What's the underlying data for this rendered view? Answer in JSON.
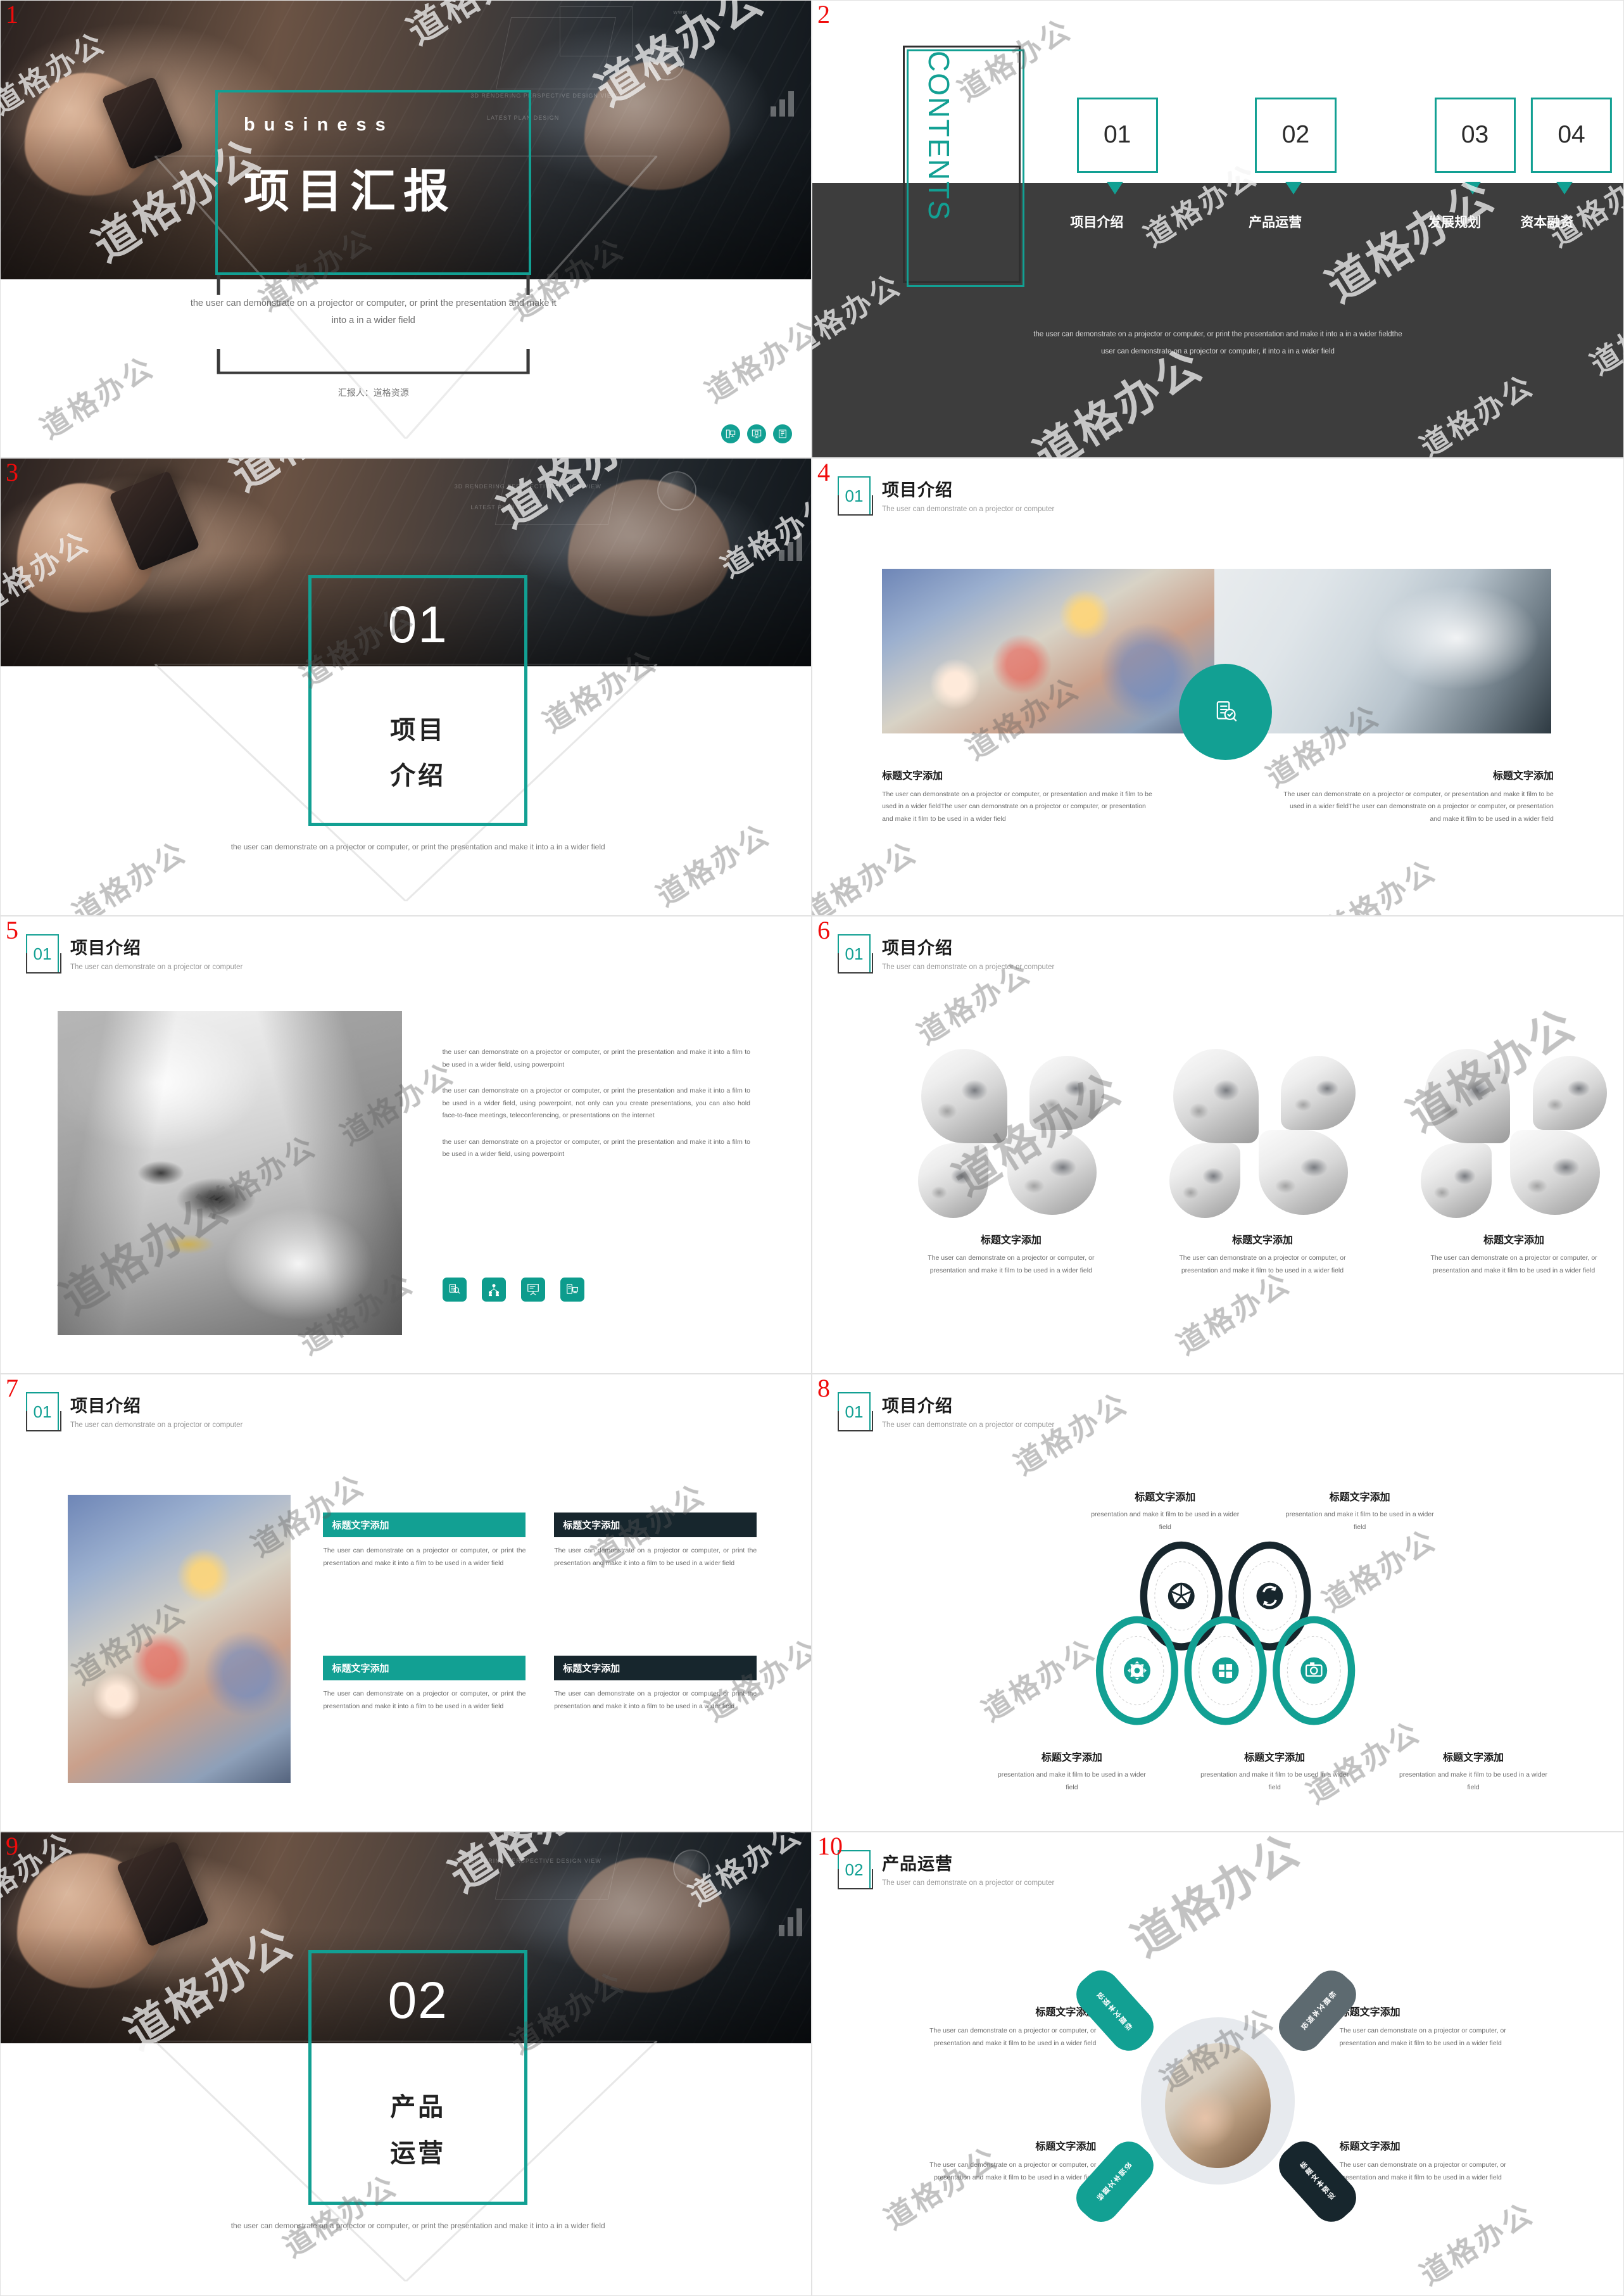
{
  "theme": {
    "teal": "#12a093",
    "dark_navy": "#17262d",
    "dark_gray": "#3d3d3d",
    "number_red": "#f00b0b"
  },
  "watermark": {
    "text": "道格办公"
  },
  "slides": [
    {
      "num": "1",
      "type": "cover",
      "english_title": "business",
      "chinese_title": "项目汇报",
      "subtitle": "the user can demonstrate on a projector or computer, or print the presentation  and make it into a in a wider field",
      "author": "汇报人：道格资源",
      "icons": [
        "desktop-computer-icon",
        "monitor-document-icon",
        "book-icon"
      ]
    },
    {
      "num": "2",
      "type": "contents",
      "word": "CONTENTS",
      "items": [
        {
          "number": "01",
          "label": "项目介绍"
        },
        {
          "number": "02",
          "label": "产品运营"
        },
        {
          "number": "03",
          "label": "发展规划"
        },
        {
          "number": "04",
          "label": "资本融资"
        }
      ],
      "footer_line1": "the user can demonstrate on a projector or computer, or print the presentation and make it into a in a wider fieldthe",
      "footer_line2": "user can demonstrate on a projector or computer, it into a in a wider field"
    },
    {
      "num": "3",
      "type": "divider",
      "number": "01",
      "title_line1": "项目",
      "title_line2": "介绍",
      "subtitle": "the user can demonstrate on a projector or computer, or print the presentation and make it into a in a wider field"
    },
    {
      "num": "4",
      "type": "content-two-col",
      "header": {
        "number": "01",
        "title": "项目介绍",
        "sub": "The user can demonstrate on a projector or computer"
      },
      "center_icon": "document-search-icon",
      "left": {
        "title": "标题文字添加",
        "body": "The user can demonstrate on a projector or computer, or presentation and make it film to be used in a wider fieldThe user can demonstrate on a projector or computer, or presentation and make it film to be used in a wider field"
      },
      "right": {
        "title": "标题文字添加",
        "body": "The user can demonstrate on a projector or computer, or presentation and make it film to be used in a wider fieldThe user can demonstrate on a projector or computer, or presentation and make it film to be used in a wider field"
      }
    },
    {
      "num": "5",
      "type": "content-image-text",
      "header": {
        "number": "01",
        "title": "项目介绍",
        "sub": "The user can demonstrate on a projector or computer"
      },
      "paragraphs": [
        "the user can demonstrate on a projector or computer, or print the presentation and make it into a film to be used in a wider field, using powerpoint",
        "the user can demonstrate on a projector or computer, or print the presentation and make it into a film to be used in a wider field, using powerpoint, not only can you create presentations, you can also hold face-to-face meetings, teleconferencing, or presentations on the internet",
        "the user can demonstrate on a projector or computer, or print the presentation and make it into a film to be used in a wider field, using powerpoint"
      ],
      "icons": [
        "document-search-icon",
        "network-people-icon",
        "presentation-board-icon",
        "document-monitor-icon"
      ]
    },
    {
      "num": "6",
      "type": "content-three-col",
      "header": {
        "number": "01",
        "title": "项目介绍",
        "sub": "The user can demonstrate on a projector or computer"
      },
      "columns": [
        {
          "title": "标题文字添加",
          "body": "The user can demonstrate on a projector or computer, or presentation and make it film to be used in a wider field"
        },
        {
          "title": "标题文字添加",
          "body": "The user can demonstrate on a projector or computer, or presentation and make it film to be used in a wider field"
        },
        {
          "title": "标题文字添加",
          "body": "The user can demonstrate on a projector or computer, or presentation and make it film to be used in a wider field"
        }
      ]
    },
    {
      "num": "7",
      "type": "content-quad",
      "header": {
        "number": "01",
        "title": "项目介绍",
        "sub": "The user can demonstrate on a projector or computer"
      },
      "cards": [
        {
          "title": "标题文字添加",
          "style": "teal",
          "body": "The user can demonstrate on a projector or computer, or print the presentation and make it into a film to be used in a wider field"
        },
        {
          "title": "标题文字添加",
          "style": "dark",
          "body": "The user can demonstrate on a projector or computer, or print the presentation and make it into a film to be used in a wider field"
        },
        {
          "title": "标题文字添加",
          "style": "teal",
          "body": "The user can demonstrate on a projector or computer, or print the presentation and make it into a film to be used in a wider field"
        },
        {
          "title": "标题文字添加",
          "style": "dark",
          "body": "The user can demonstrate on a projector or computer, or print the presentation and make it into a film to be used in a wider field"
        }
      ]
    },
    {
      "num": "8",
      "type": "content-rings",
      "header": {
        "number": "01",
        "title": "项目介绍",
        "sub": "The user can demonstrate on a projector or computer"
      },
      "top": [
        {
          "title": "标题文字添加",
          "body": "presentation and make it film to be used in a wider field",
          "icon": "aperture-icon",
          "color": "#17262d"
        },
        {
          "title": "标题文字添加",
          "body": "presentation and make it film to be used in a wider field",
          "icon": "refresh-icon",
          "color": "#17262d"
        }
      ],
      "bottom": [
        {
          "title": "标题文字添加",
          "body": "presentation and make it film to be used in a wider field",
          "icon": "gear-icon",
          "color": "#12a093"
        },
        {
          "title": "标题文字添加",
          "body": "presentation and make it film to be used in a wider field",
          "icon": "windows-icon",
          "color": "#12a093"
        },
        {
          "title": "标题文字添加",
          "body": "presentation and make it film to be used in a wider field",
          "icon": "camera-icon",
          "color": "#12a093"
        }
      ]
    },
    {
      "num": "9",
      "type": "divider",
      "number": "02",
      "title_line1": "产品",
      "title_line2": "运营",
      "subtitle": "the user can demonstrate on a projector or computer, or print the presentation and make it into a in a wider field"
    },
    {
      "num": "10",
      "type": "content-x-diagram",
      "header": {
        "number": "02",
        "title": "产品运营",
        "sub": "The user can demonstrate on a projector or computer"
      },
      "pill_label": "标题文本预设",
      "quadrants": [
        {
          "title": "标题文字添加",
          "body": "The user can demonstrate on a projector or computer, or presentation and make it film to be used in a wider field",
          "align": "right"
        },
        {
          "title": "标题文字添加",
          "body": "The user can demonstrate on a projector or computer, or presentation and make it film to be used in a wider field",
          "align": "left"
        },
        {
          "title": "标题文字添加",
          "body": "The user can demonstrate on a projector or computer, or presentation and make it film to be used in a wider field",
          "align": "right"
        },
        {
          "title": "标题文字添加",
          "body": "The user can demonstrate on a projector or computer, or presentation and make it film to be used in a wider field",
          "align": "left"
        }
      ]
    }
  ]
}
